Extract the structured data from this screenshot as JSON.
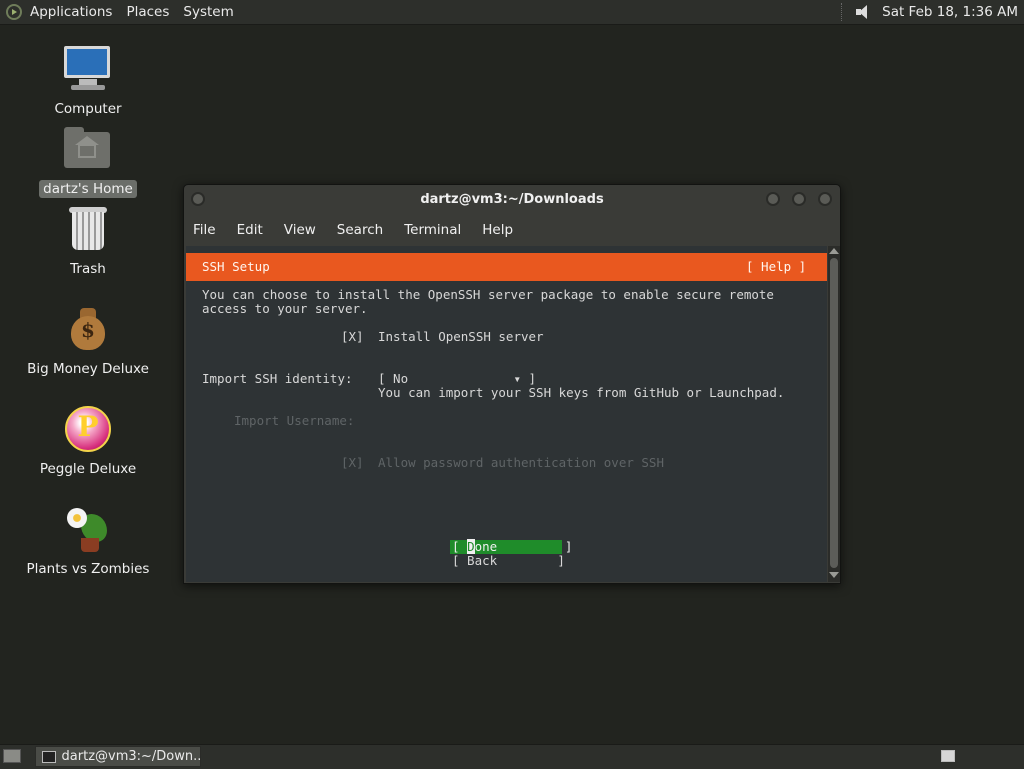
{
  "top_panel": {
    "menus": [
      "Applications",
      "Places",
      "System"
    ],
    "clock": "Sat Feb 18,  1:36 AM"
  },
  "desktop": {
    "icons": [
      {
        "label": "Computer",
        "icon": "computer-icon"
      },
      {
        "label": "dartz's Home",
        "icon": "home-folder-icon"
      },
      {
        "label": "Trash",
        "icon": "trash-icon"
      },
      {
        "label": "Big Money Deluxe",
        "icon": "money-bag-icon"
      },
      {
        "label": "Peggle Deluxe",
        "icon": "peggle-icon"
      },
      {
        "label": "Plants vs Zombies",
        "icon": "plants-vs-zombies-icon"
      }
    ]
  },
  "window": {
    "title": "dartz@vm3:~/Downloads",
    "menus": [
      "File",
      "Edit",
      "View",
      "Search",
      "Terminal",
      "Help"
    ]
  },
  "installer": {
    "header_title": "SSH Setup",
    "help": "[ Help ]",
    "intro_line1": "You can choose to install the OpenSSH server package to enable secure remote",
    "intro_line2": "access to your server.",
    "install_checkbox": "[X]",
    "install_label": "Install OpenSSH server",
    "import_label": "Import SSH identity:",
    "import_value": "[ No              ▾ ]",
    "import_hint": "You can import your SSH keys from GitHub or Launchpad.",
    "import_username_label": "Import Username:",
    "password_checkbox": "[X]",
    "password_label": "Allow password authentication over SSH",
    "done_prefix": "[ ",
    "done_cursor": "D",
    "done_rest": "one         ]",
    "back": "[ Back        ]"
  },
  "taskbar": {
    "task_label": "dartz@vm3:~/Down..."
  },
  "colors": {
    "header": "#e9581f",
    "done_button": "#1f8c2a",
    "terminal_bg": "#2e3335"
  }
}
